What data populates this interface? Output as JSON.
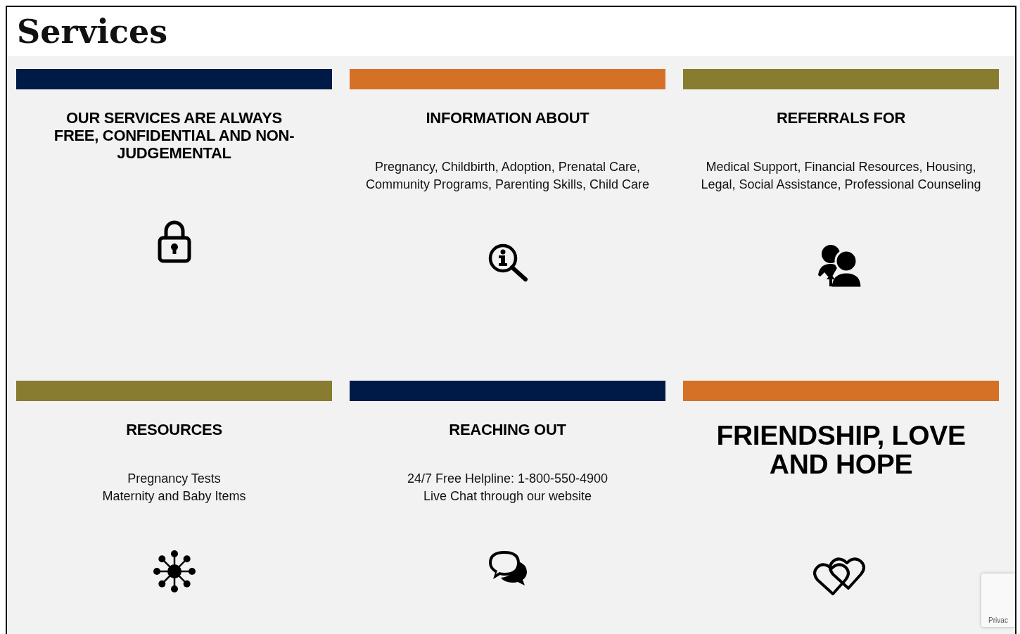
{
  "title": "Services",
  "cards": [
    {
      "color": "#001a47",
      "kind": "standard",
      "title": "OUR SERVICES ARE ALWAYS FREE, CONFIDENTIAL AND NON-JUDGEMENTAL"
    },
    {
      "color": "#d57127",
      "kind": "standard",
      "title": "INFORMATION ABOUT",
      "lines": [
        "Pregnancy, Childbirth, Adoption, Prenatal Care,",
        "Community Programs, Parenting Skills, Child Care"
      ]
    },
    {
      "color": "#877c2f",
      "kind": "standard",
      "title": "REFERRALS FOR",
      "lines": [
        "Medical Support, Financial Resources, Housing,",
        "Legal, Social Assistance, Professional Counseling"
      ]
    },
    {
      "color": "#877c2f",
      "kind": "standard",
      "title": "RESOURCES",
      "lines": [
        "Pregnancy Tests",
        "Maternity and Baby Items"
      ]
    },
    {
      "color": "#001a47",
      "kind": "standard",
      "title": "REACHING OUT",
      "lines": [
        "24/7 Free Helpline: 1-800-550-4900",
        "Live Chat through our website"
      ]
    },
    {
      "color": "#d57127",
      "kind": "large",
      "title": "FRIENDSHIP, LOVE AND HOPE"
    }
  ],
  "recaptcha": {
    "text": "Privac"
  }
}
